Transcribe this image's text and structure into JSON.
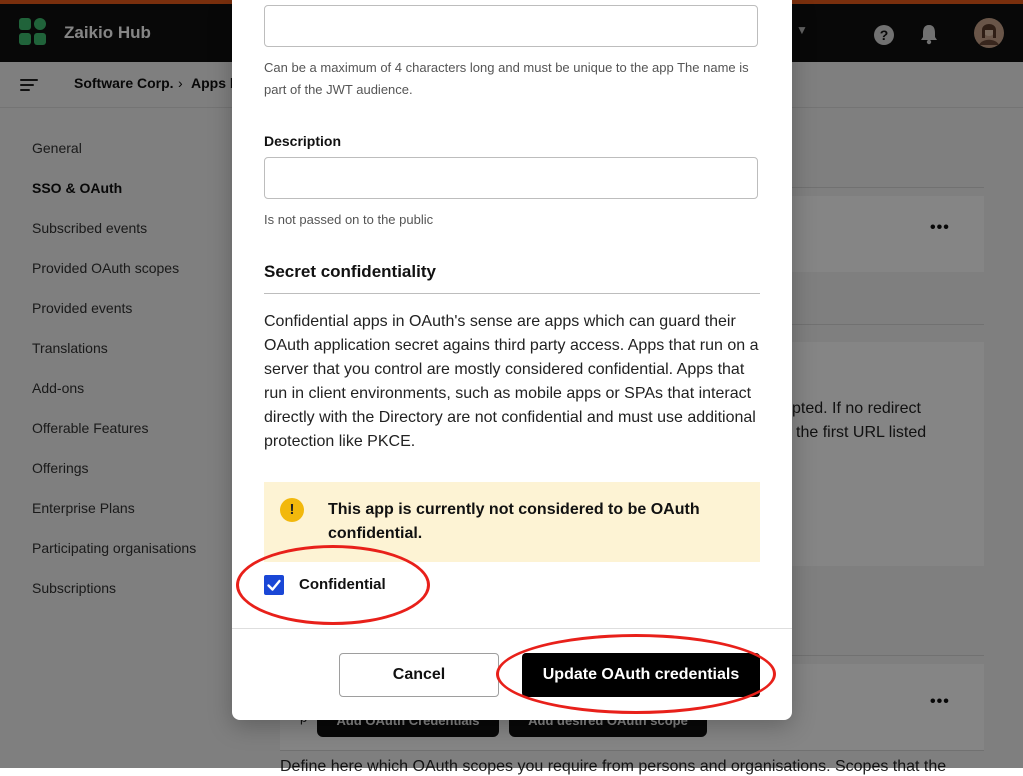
{
  "colors": {
    "accent": "#e85a1a",
    "annotation": "#e8201a",
    "checkbox": "#1a47d6",
    "alert_bg": "#fdf3d4"
  },
  "header": {
    "app_name": "Zaikio Hub",
    "dropdown_icon": "chevron-down-icon",
    "help_icon": "question-circle-icon",
    "bell_icon": "bell-icon"
  },
  "breadcrumb": {
    "org": "Software Corp.",
    "separator": "›",
    "current": "Apps b"
  },
  "sidebar": {
    "items": [
      {
        "label": "General"
      },
      {
        "label": "SSO & OAuth",
        "active": true
      },
      {
        "label": "Subscribed events"
      },
      {
        "label": "Provided OAuth scopes"
      },
      {
        "label": "Provided events"
      },
      {
        "label": "Translations"
      },
      {
        "label": "Add-ons"
      },
      {
        "label": "Offerable Features"
      },
      {
        "label": "Offerings"
      },
      {
        "label": "Enterprise Plans"
      },
      {
        "label": "Participating organisations"
      },
      {
        "label": "Subscriptions"
      }
    ]
  },
  "background": {
    "redirect_text_1": "pted. If no redirect",
    "redirect_text_2": "the first URL listed",
    "add_credentials_btn": "Add OAuth Credentials",
    "add_scope_btn": "Add desired OAuth scope",
    "scopes_text": "Define here which OAuth scopes you require from persons and organisations. Scopes that the",
    "small_p": "p"
  },
  "modal": {
    "name_hint": "Can be a maximum of 4 characters long and must be unique to the app The name is part of the JWT audience.",
    "description_label": "Description",
    "description_hint": "Is not passed on to the public",
    "section_title": "Secret confidentiality",
    "confidentiality_text": "Confidential apps in OAuth's sense are apps which can guard their OAuth application secret agains third party access. Apps that run on a server that you control are mostly considered confidential. Apps that run in client environments, such as mobile apps or SPAs that interact directly with the Directory are not confidential and must use additional protection like PKCE.",
    "alert_icon": "exclamation-icon",
    "alert_text": "This app is currently not considered to be OAuth confidential.",
    "confidential_label": "Confidential",
    "confidential_checked": true,
    "cancel_label": "Cancel",
    "update_label": "Update OAuth credentials"
  }
}
